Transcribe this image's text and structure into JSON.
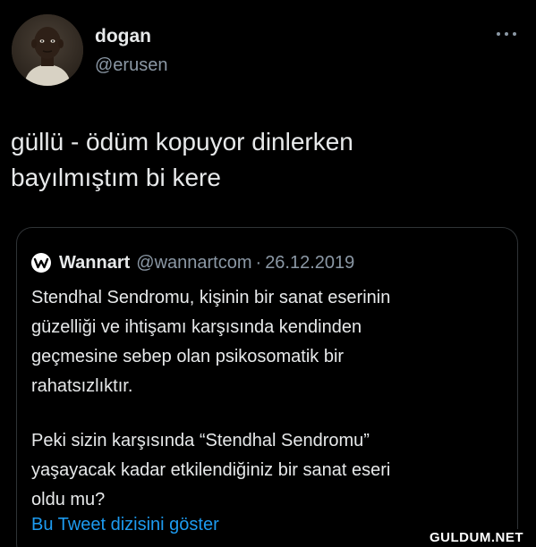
{
  "tweet": {
    "author_name": "dogan",
    "author_handle": "@erusen",
    "text_lines": [
      "güllü - ödüm kopuyor dinlerken",
      "bayılmıştım bi kere"
    ]
  },
  "quote": {
    "name": "Wannart",
    "handle": "@wannartcom",
    "separator": "·",
    "date": "26.12.2019",
    "paragraph1": [
      "Stendhal Sendromu, kişinin bir sanat eserinin",
      "güzelliği ve ihtişamı karşısında kendinden",
      "geçmesine sebep olan psikosomatik bir",
      "rahatsızlıktır."
    ],
    "paragraph2": [
      "Peki sizin karşısında “Stendhal Sendromu”",
      "yaşayacak kadar etkilendiğiniz bir sanat eseri",
      "oldu mu?"
    ],
    "show_thread": "Bu Tweet dizisini göster"
  },
  "watermark": "GULDUM.NET",
  "icons": {
    "avatar": "avatar-photo",
    "more": "more-dots-icon",
    "quote_logo": "wannart-logo-icon"
  },
  "colors": {
    "background": "#000000",
    "text_primary": "#e7e9ea",
    "text_secondary": "#8b98a5",
    "link": "#1d9bf0",
    "border": "#2f3336"
  }
}
